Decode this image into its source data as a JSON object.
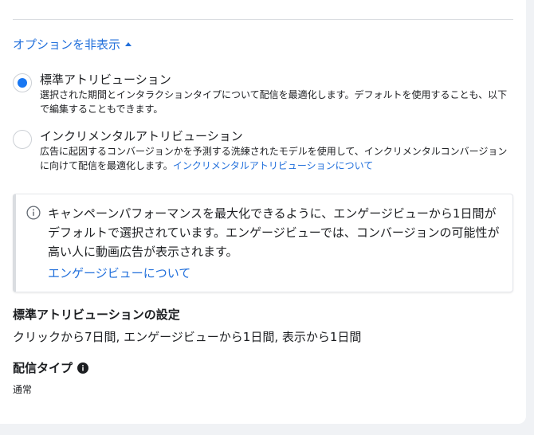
{
  "options_toggle": {
    "label": "オプションを非表示"
  },
  "attribution_options": [
    {
      "title": "標準アトリビューション",
      "description": "選択された期間とインタラクションタイプについて配信を最適化します。デフォルトを使用することも、以下で編集することもできます。",
      "selected": true
    },
    {
      "title": "インクリメンタルアトリビューション",
      "description": "広告に起因するコンバージョンかを予測する洗練されたモデルを使用して、インクリメンタルコンバージョンに向けて配信を最適化します。",
      "link": "インクリメンタルアトリビューションについて",
      "selected": false
    }
  ],
  "info_box": {
    "text": "キャンペーンパフォーマンスを最大化できるように、エンゲージビューから1日間がデフォルトで選択されています。エンゲージビューでは、コンバージョンの可能性が高い人に動画広告が表示されます。",
    "link": "エンゲージビューについて"
  },
  "standard_settings": {
    "title": "標準アトリビューションの設定",
    "value": "クリックから7日間, エンゲージビューから1日間, 表示から1日間"
  },
  "delivery_type": {
    "title": "配信タイプ",
    "value": "通常"
  },
  "colors": {
    "accent": "#1877f2",
    "link": "#216fdb",
    "text": "#1c1e21",
    "background": "#f0f2f5"
  },
  "icons": {
    "toggle": "caret-up-icon",
    "info_box": "info-outline-icon",
    "delivery_type": "info-filled-icon"
  }
}
